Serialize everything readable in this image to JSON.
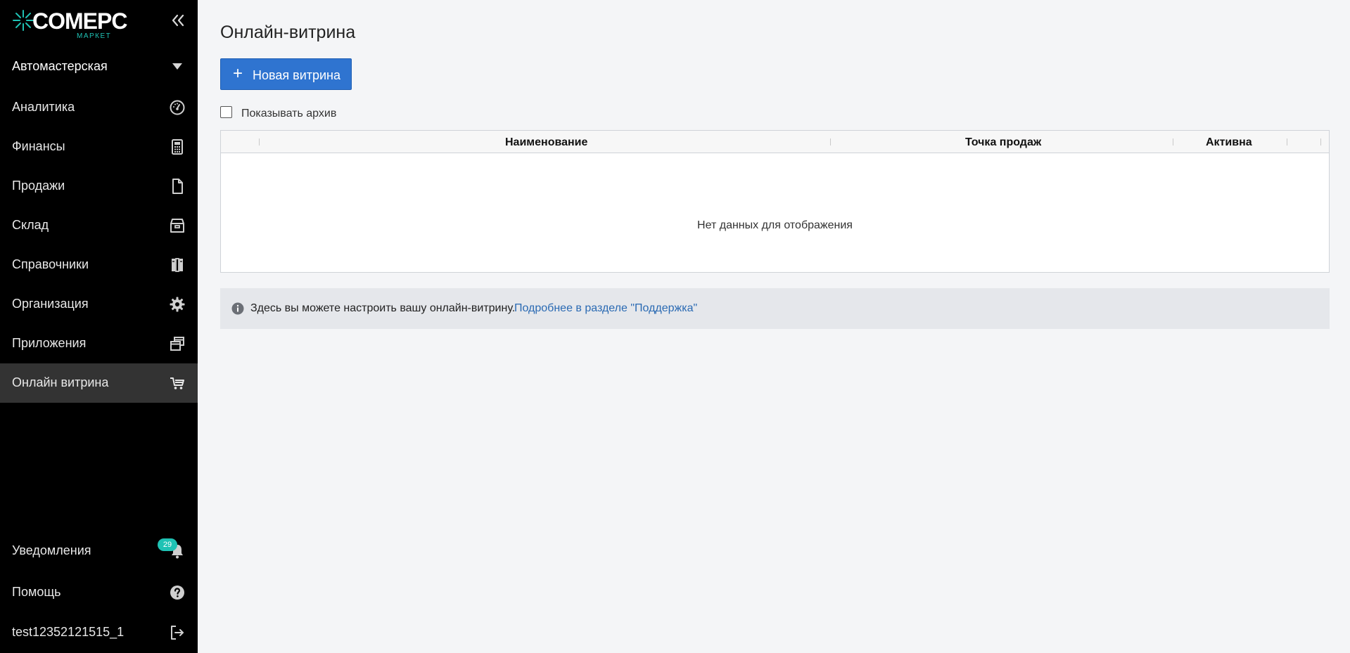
{
  "brand": {
    "name": "COMEPC",
    "sub": "МАРКЕТ",
    "accent": "#1fc2b4"
  },
  "sidebar": {
    "collapse_icon": "double-chevron-left-icon",
    "company": "Автомастерская",
    "items": [
      {
        "label": "Аналитика",
        "icon": "dashboard-gauge-icon"
      },
      {
        "label": "Финансы",
        "icon": "calculator-icon"
      },
      {
        "label": "Продажи",
        "icon": "document-icon"
      },
      {
        "label": "Склад",
        "icon": "warehouse-box-icon"
      },
      {
        "label": "Справочники",
        "icon": "books-icon"
      },
      {
        "label": "Организация",
        "icon": "gear-icon"
      },
      {
        "label": "Приложения",
        "icon": "windows-stack-icon"
      },
      {
        "label": "Онлайн витрина",
        "icon": "shopping-cart-icon",
        "active": true
      }
    ],
    "footer": [
      {
        "label": "Уведомления",
        "icon": "bell-icon",
        "badge": "29"
      },
      {
        "label": "Помощь",
        "icon": "question-circle-icon"
      },
      {
        "label": "test12352121515_1",
        "icon": "logout-icon"
      }
    ],
    "active_bg": "#333333"
  },
  "main": {
    "title": "Онлайн-витрина",
    "new_button": "Новая витрина",
    "archive_label": "Показывать архив",
    "archive_checked": false,
    "grid": {
      "columns": [
        "Наименование",
        "Точка продаж",
        "Активна"
      ],
      "empty": "Нет данных для отображения"
    },
    "info": {
      "text": "Здесь вы можете настроить вашу онлайн-витрину.",
      "link": "Подробнее в разделе \"Поддержка\""
    },
    "primary_color": "#2f74d0"
  }
}
